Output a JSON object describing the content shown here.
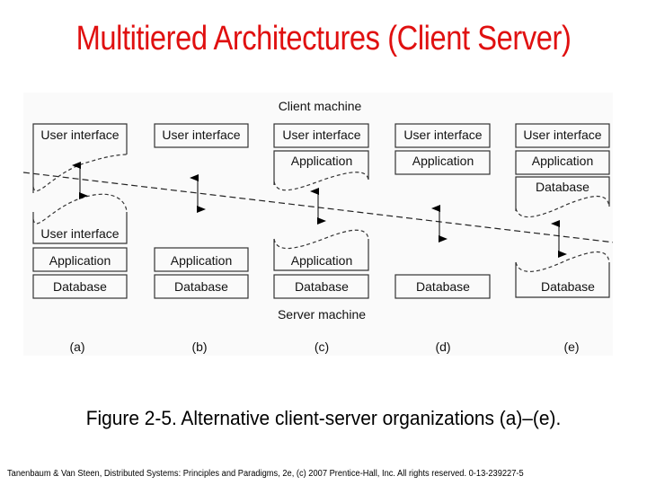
{
  "title": "Multitiered Architectures (Client Server)",
  "colors": {
    "title": "#e01010",
    "box_border": "#333333",
    "figure_bg": "#fafafa"
  },
  "diagram": {
    "client_label": "Client machine",
    "server_label": "Server machine",
    "columns": [
      {
        "id": "a",
        "label": "(a)",
        "client": [
          "User interface (split)"
        ],
        "server": [
          "User interface (split)",
          "Application",
          "Database"
        ],
        "split_layer": "User interface"
      },
      {
        "id": "b",
        "label": "(b)",
        "client": [
          "User interface"
        ],
        "server": [
          "Application",
          "Database"
        ],
        "split_layer": null
      },
      {
        "id": "c",
        "label": "(c)",
        "client": [
          "User interface",
          "Application (split)"
        ],
        "server": [
          "Application (split)",
          "Database"
        ],
        "split_layer": "Application"
      },
      {
        "id": "d",
        "label": "(d)",
        "client": [
          "User interface",
          "Application"
        ],
        "server": [
          "Database"
        ],
        "split_layer": null
      },
      {
        "id": "e",
        "label": "(e)",
        "client": [
          "User interface",
          "Application",
          "Database (split)"
        ],
        "server": [
          "Database (split)"
        ],
        "split_layer": "Database"
      }
    ],
    "texts": {
      "ui": "User interface",
      "app": "Application",
      "db": "Database"
    }
  },
  "caption": "Figure 2-5. Alternative client-server organizations (a)–(e).",
  "footer": "Tanenbaum & Van Steen, Distributed Systems: Principles and Paradigms, 2e, (c) 2007 Prentice-Hall, Inc. All rights reserved. 0-13-239227-5"
}
